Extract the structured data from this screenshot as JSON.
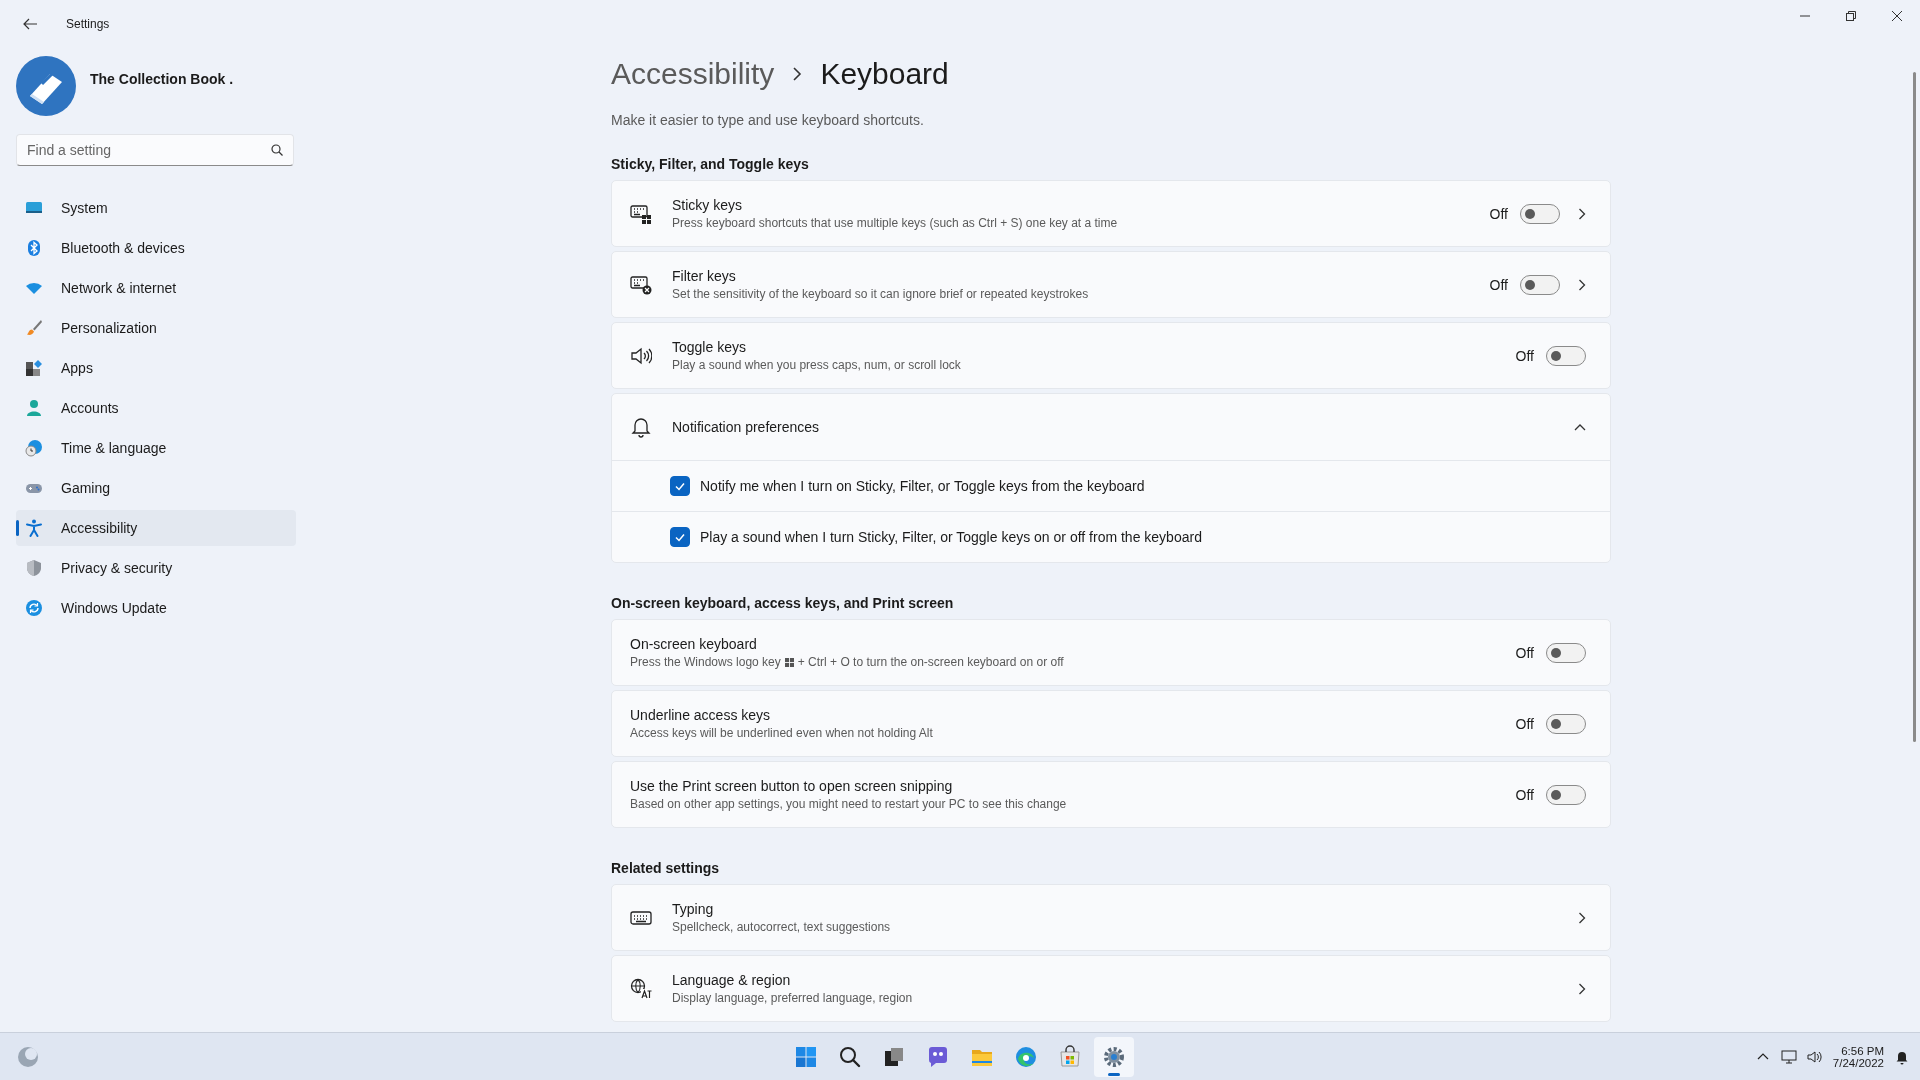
{
  "window": {
    "title": "Settings"
  },
  "profile": {
    "name": "The Collection Book ."
  },
  "search": {
    "placeholder": "Find a setting"
  },
  "nav": [
    {
      "label": "System",
      "selected": false
    },
    {
      "label": "Bluetooth & devices",
      "selected": false
    },
    {
      "label": "Network & internet",
      "selected": false
    },
    {
      "label": "Personalization",
      "selected": false
    },
    {
      "label": "Apps",
      "selected": false
    },
    {
      "label": "Accounts",
      "selected": false
    },
    {
      "label": "Time & language",
      "selected": false
    },
    {
      "label": "Gaming",
      "selected": false
    },
    {
      "label": "Accessibility",
      "selected": true
    },
    {
      "label": "Privacy & security",
      "selected": false
    },
    {
      "label": "Windows Update",
      "selected": false
    }
  ],
  "breadcrumb": {
    "parent": "Accessibility",
    "current": "Keyboard"
  },
  "description": "Make it easier to type and use keyboard shortcuts.",
  "sections": [
    {
      "title": "Sticky, Filter, and Toggle keys",
      "items": [
        {
          "kind": "toggle",
          "title": "Sticky keys",
          "subtitle_parts": [
            "Press keyboard shortcuts that use multiple keys (such as Ctrl + S) one key at a time"
          ],
          "state_label": "Off",
          "on": false,
          "chevron": true
        },
        {
          "kind": "toggle",
          "title": "Filter keys",
          "subtitle_parts": [
            "Set the sensitivity of the keyboard so it can ignore brief or repeated keystrokes"
          ],
          "state_label": "Off",
          "on": false,
          "chevron": true
        },
        {
          "kind": "toggle",
          "title": "Toggle keys",
          "subtitle_parts": [
            "Play a sound when you press caps, num, or scroll lock"
          ],
          "state_label": "Off",
          "on": false,
          "chevron": false
        },
        {
          "kind": "expander",
          "title": "Notification preferences",
          "expanded": true,
          "options": [
            {
              "label": "Notify me when I turn on Sticky, Filter, or Toggle keys from the keyboard",
              "checked": true
            },
            {
              "label": "Play a sound when I turn Sticky, Filter, or Toggle keys on or off from the keyboard",
              "checked": true
            }
          ]
        }
      ]
    },
    {
      "title": "On-screen keyboard, access keys, and Print screen",
      "items": [
        {
          "kind": "toggle",
          "title": "On-screen keyboard",
          "subtitle_parts": [
            "Press the Windows logo key",
            "+ Ctrl + O to turn the on-screen keyboard on or off"
          ],
          "state_label": "Off",
          "on": false,
          "chevron": false
        },
        {
          "kind": "toggle",
          "title": "Underline access keys",
          "subtitle_parts": [
            "Access keys will be underlined even when not holding Alt"
          ],
          "state_label": "Off",
          "on": false,
          "chevron": false
        },
        {
          "kind": "toggle",
          "title": "Use the Print screen button to open screen snipping",
          "subtitle_parts": [
            "Based on other app settings, you might need to restart your PC to see this change"
          ],
          "state_label": "Off",
          "on": false,
          "chevron": false
        }
      ]
    },
    {
      "title": "Related settings",
      "items": [
        {
          "kind": "link",
          "title": "Typing",
          "subtitle_parts": [
            "Spellcheck, autocorrect, text suggestions"
          ]
        },
        {
          "kind": "link",
          "title": "Language & region",
          "subtitle_parts": [
            "Display language, preferred language, region"
          ]
        }
      ]
    }
  ],
  "taskbar": {
    "apps": [
      {
        "selected": false
      },
      {
        "selected": false
      },
      {
        "selected": false
      },
      {
        "selected": false
      },
      {
        "selected": false
      },
      {
        "selected": false
      },
      {
        "selected": false
      },
      {
        "selected": true
      }
    ],
    "time": "6:56 PM",
    "date": "7/24/2022"
  }
}
